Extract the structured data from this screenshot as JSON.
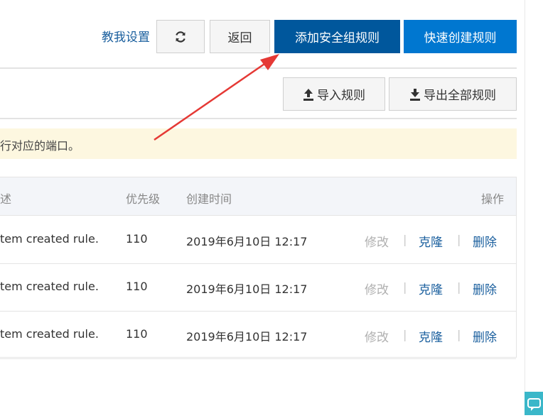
{
  "toolbar": {
    "help_link": "教我设置",
    "refresh_icon": "refresh-icon",
    "back_label": "返回",
    "add_rule_label": "添加安全组规则",
    "quick_create_label": "快速创建规则"
  },
  "actions": {
    "import_label": "导入规则",
    "import_icon": "upload-icon",
    "export_label": "导出全部规则",
    "export_icon": "download-icon"
  },
  "notice": {
    "text": "行对应的端口。"
  },
  "table": {
    "headers": {
      "description": "述",
      "priority": "优先级",
      "created": "创建时间",
      "operations": "操作"
    },
    "rows": [
      {
        "description": "tem created rule.",
        "priority": "110",
        "created": "2019年6月10日 12:17",
        "modify": "修改",
        "clone": "克隆",
        "delete": "删除"
      },
      {
        "description": "tem created rule.",
        "priority": "110",
        "created": "2019年6月10日 12:17",
        "modify": "修改",
        "clone": "克隆",
        "delete": "删除"
      },
      {
        "description": "tem created rule.",
        "priority": "110",
        "created": "2019年6月10日 12:17",
        "modify": "修改",
        "clone": "克隆",
        "delete": "删除"
      }
    ],
    "separator": "|"
  },
  "colors": {
    "primary": "#0077d0",
    "primary_active": "#00579c",
    "link": "#1a5f9e",
    "notice_bg": "#fdf7e0",
    "annotation_arrow": "#e53935"
  }
}
